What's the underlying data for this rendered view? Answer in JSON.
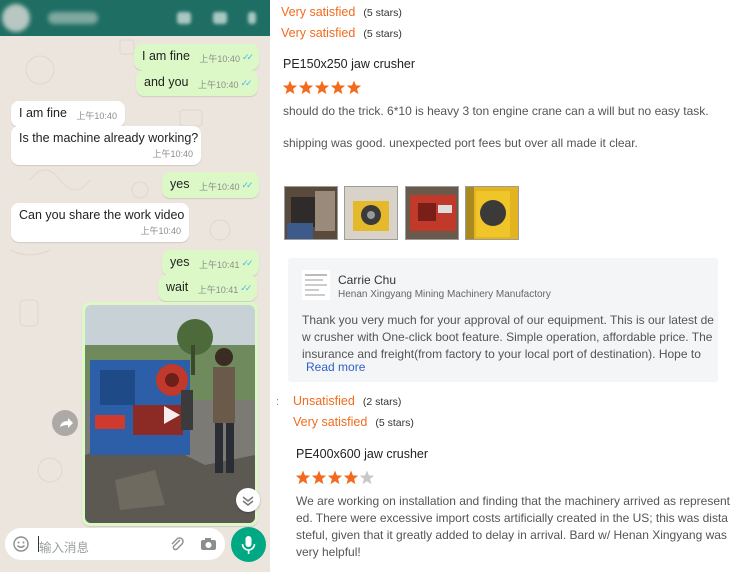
{
  "chat": {
    "messages": [
      {
        "text": "I am fine",
        "time": "上午10:40",
        "dir": "out"
      },
      {
        "text": "and you",
        "time": "上午10:40",
        "dir": "out"
      },
      {
        "text": "I am fine",
        "time": "上午10:40",
        "dir": "in"
      },
      {
        "text": "Is the machine already working?",
        "time": "上午10:40",
        "dir": "in"
      },
      {
        "text": "yes",
        "time": "上午10:40",
        "dir": "out"
      },
      {
        "text": "Can you share the work video",
        "time": "上午10:40",
        "dir": "in"
      },
      {
        "text": "yes",
        "time": "上午10:41",
        "dir": "out"
      },
      {
        "text": "wait",
        "time": "上午10:41",
        "dir": "out"
      }
    ],
    "input_placeholder": "输入消息"
  },
  "reviews": {
    "top_ratings": [
      {
        "label": "Very satisfied",
        "count": "(5 stars)"
      },
      {
        "label": "Very satisfied",
        "count": "(5 stars)"
      }
    ],
    "review1": {
      "product": "PE150x250 jaw crusher",
      "stars": 5,
      "text1": "should do the trick. 6*10 is heavy 3 ton engine crane can a will but no easy task.",
      "text2": "shipping was good.  unexpected port fees but over all made it clear."
    },
    "reply": {
      "name": "Carrie Chu",
      "company": "Henan Xingyang Mining Machinery Manufactory",
      "line1": "Thank you very much for your approval of our equipment. This is our latest de",
      "line2": "w crusher with One-click boot feature. Simple operation, affordable price. The",
      "line3": "insurance and freight(from factory to your local port of destination). Hope to",
      "read_more": "Read more"
    },
    "mid_ratings": [
      {
        "label": "Unsatisfied",
        "count": "(2 stars)"
      },
      {
        "label": "Very satisfied",
        "count": "(5 stars)"
      }
    ],
    "review2": {
      "product": "PE400x600 jaw crusher",
      "stars": 4,
      "text1": "We are working on installation and finding that the machinery arrived as represent",
      "text2": "ed.  There were excessive import costs artificially created in the US; this was dista",
      "text3": "steful, given that it greatly added to delay in arrival.  Bard w/ Henan Xingyang was",
      "text4": "very helpful!"
    },
    "star_color": "#f26b1d"
  },
  "colors": {
    "outgoing_bubble": "#dcf8c6",
    "incoming_bubble": "#ffffff",
    "chat_header": "#1f6e63",
    "mic_button": "#00a884",
    "rating_orange": "#f26b1d",
    "link_blue": "#2f62c8"
  }
}
